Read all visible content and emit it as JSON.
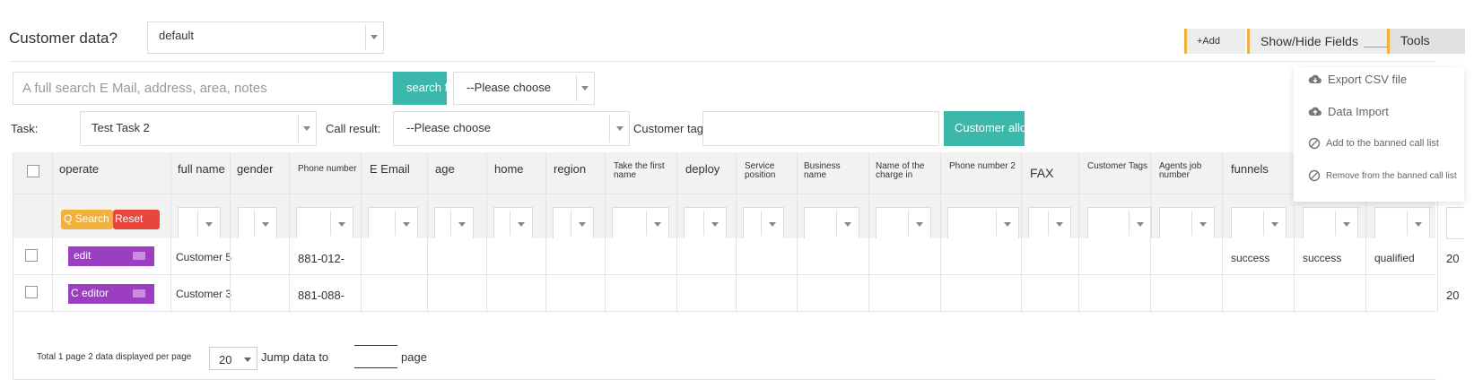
{
  "header": {
    "title": "Customer data?",
    "view_select": "default",
    "add_btn": "+Add",
    "showhide_btn": "Show/Hide Fields",
    "tools_btn": "Tools"
  },
  "tools_menu": {
    "items": [
      "Export CSV file",
      "Data Import",
      "Add to the banned call list",
      "Remove from the banned call list"
    ]
  },
  "search": {
    "placeholder": "A full search E Mail, address, area, notes",
    "button": "search f",
    "select": "--Please choose"
  },
  "filters": {
    "task_label": "Task:",
    "task_value": "Test Task 2",
    "call_result_label": "Call result:",
    "call_result_value": "--Please choose",
    "customer_tags_label": "Customer tags:",
    "customer_tags_value": "",
    "allocate_button": "Customer allo"
  },
  "table": {
    "columns": [
      "operate",
      "full name",
      "gender",
      "Phone number",
      "E Email",
      "age",
      "home",
      "region",
      "Take the first name",
      "deploy",
      "Service position",
      "Business name",
      "Name of the charge in",
      "Phone number 2",
      "FAX",
      "Customer Tags",
      "Agents job number",
      "funnels"
    ],
    "search_button": "Q Search",
    "reset_button": "Reset",
    "rows": [
      {
        "action": "edit",
        "full_name": "Customer 5",
        "phone": "881-012-",
        "funnels": "success",
        "col19": "success",
        "col20": "qualified",
        "col21": "20"
      },
      {
        "action": "C editor",
        "full_name": "Customer 3",
        "phone": "881-088-",
        "funnels": "",
        "col19": "",
        "col20": "",
        "col21": "20"
      }
    ]
  },
  "footer": {
    "total_text": "Total 1 page 2 data displayed per page",
    "per_page": "20",
    "jump_text": "Jump data to",
    "page_input": "",
    "page_text": "page"
  },
  "colors": {
    "accent_teal": "#3cb7ab",
    "orange_border": "#f0b23c",
    "purple": "#9b3fc0",
    "search_yellow": "#f0b23c",
    "reset_red": "#e8453c"
  }
}
